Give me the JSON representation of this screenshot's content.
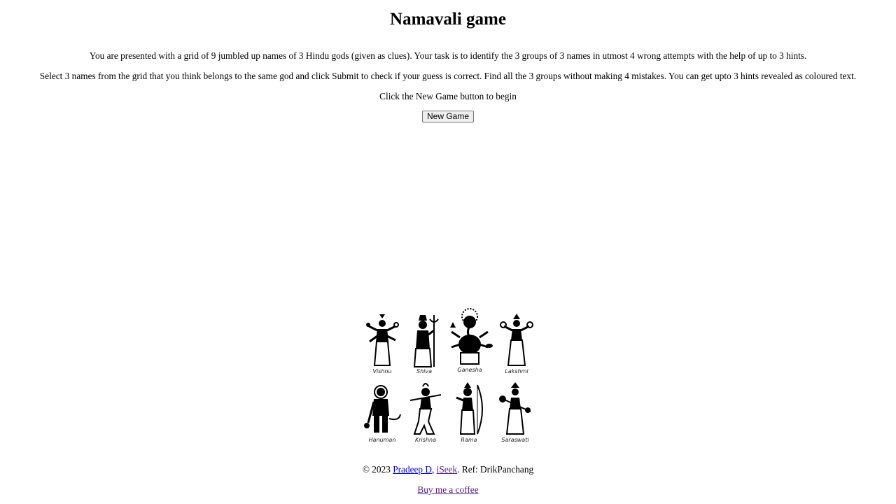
{
  "page": {
    "title": "Namavali game",
    "intro1": "You are presented with a grid of 9 jumbled up names of 3 Hindu gods (given as clues). Your task is to identify the 3 groups of 3 names in utmost 4 wrong attempts with the help of up to 3 hints.",
    "intro2": "Select 3 names from the grid that you think belongs to the same god and click Submit to check if your guess is correct. Find all the 3 groups without making 4 mistakes. You can get upto 3 hints revealed as coloured text.",
    "intro3": "Click the New Game button to begin",
    "new_game_label": "New Game"
  },
  "gods": [
    {
      "name": "Vishnu",
      "icon": "vishnu-figure-icon"
    },
    {
      "name": "Shiva",
      "icon": "shiva-figure-icon"
    },
    {
      "name": "Ganesha",
      "icon": "ganesha-figure-icon"
    },
    {
      "name": "Lakshmi",
      "icon": "lakshmi-figure-icon"
    },
    {
      "name": "Hanuman",
      "icon": "hanuman-figure-icon"
    },
    {
      "name": "Krishna",
      "icon": "krishna-figure-icon"
    },
    {
      "name": "Rama",
      "icon": "rama-figure-icon"
    },
    {
      "name": "Saraswati",
      "icon": "saraswati-figure-icon"
    }
  ],
  "footer": {
    "copyright": "© 2023 ",
    "author_link": "Pradeep D",
    "sep": ", ",
    "site_link": "iSeek",
    "ref": ". Ref: DrikPanchang",
    "coffee_link": "Buy me a coffee"
  },
  "colors": {
    "link": "#0000ee",
    "visited_link": "#551a8b",
    "text": "#000000",
    "background": "#ffffff"
  }
}
